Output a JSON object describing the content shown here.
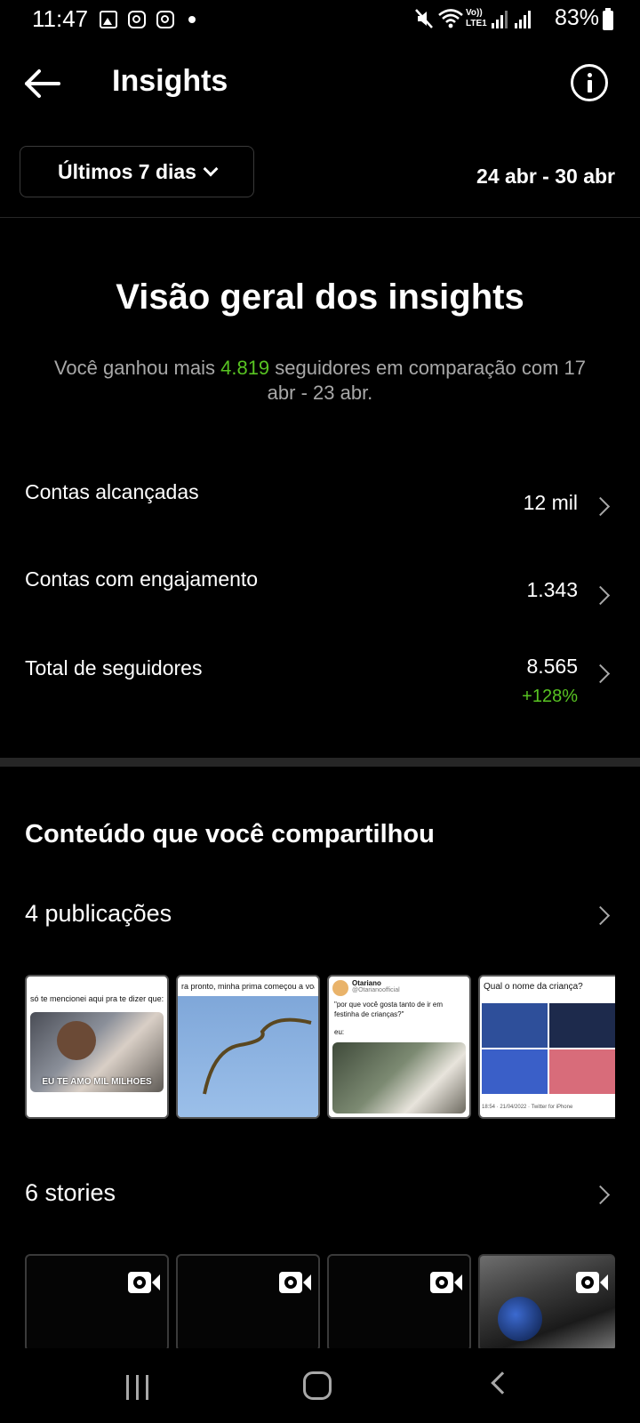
{
  "status_bar": {
    "time": "11:47",
    "battery": "83%",
    "lte_label": "LTE1",
    "volte_label": "Vo))"
  },
  "header": {
    "title": "Insights"
  },
  "period": {
    "selector_label": "Últimos 7 dias",
    "date_range": "24 abr - 30 abr"
  },
  "overview": {
    "title": "Visão geral dos insights",
    "subtitle_pre": "Você ganhou mais ",
    "subtitle_highlight": "4.819",
    "subtitle_post": " seguidores em comparação com 17 abr - 23 abr.",
    "metrics": [
      {
        "label": "Contas alcançadas",
        "value": "12 mil"
      },
      {
        "label": "Contas com engajamento",
        "value": "1.343"
      },
      {
        "label": "Total de seguidores",
        "value": "8.565",
        "delta": "+128%"
      }
    ]
  },
  "content": {
    "title": "Conteúdo que você compartilhou",
    "posts_label": "4 publicações",
    "posts": [
      {
        "caption": "só te mencionei aqui pra te dizer que:",
        "overlay": "EU TE AMO MIL MILHOES"
      },
      {
        "caption": "ra pronto, minha prima começou a voa"
      },
      {
        "author": "Otariano",
        "handle": "@Otarianoofficial",
        "caption": "\"por que você gosta tanto de ir em festinha de crianças?\"",
        "caption2": "eu:"
      },
      {
        "caption": "Qual o nome da criança?",
        "footer": "18:54 · 21/04/2022 · Twitter for iPhone"
      }
    ],
    "stories_label": "6 stories"
  },
  "colors": {
    "background": "#000000",
    "accent_green": "#58c322",
    "muted_text": "#a8a8a8",
    "divider": "#262626"
  }
}
